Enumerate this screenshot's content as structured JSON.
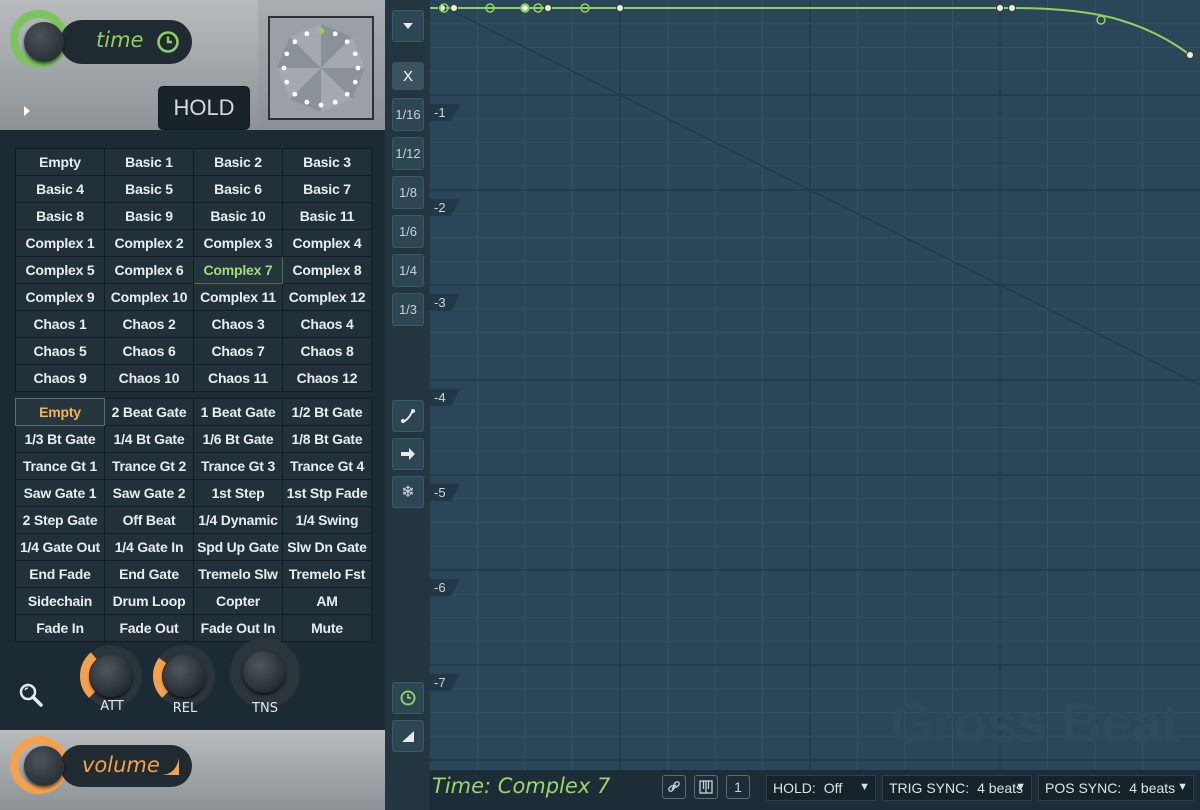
{
  "header": {
    "mode_label": "time",
    "hold_label": "HOLD"
  },
  "time_presets": [
    [
      "Empty",
      "Basic 1",
      "Basic 2",
      "Basic 3"
    ],
    [
      "Basic 4",
      "Basic 5",
      "Basic 6",
      "Basic 7"
    ],
    [
      "Basic 8",
      "Basic 9",
      "Basic 10",
      "Basic 11"
    ],
    [
      "Complex 1",
      "Complex 2",
      "Complex 3",
      "Complex 4"
    ],
    [
      "Complex 5",
      "Complex 6",
      "Complex 7",
      "Complex 8"
    ],
    [
      "Complex 9",
      "Complex 10",
      "Complex 11",
      "Complex 12"
    ],
    [
      "Chaos 1",
      "Chaos 2",
      "Chaos 3",
      "Chaos 4"
    ],
    [
      "Chaos 5",
      "Chaos 6",
      "Chaos 7",
      "Chaos 8"
    ],
    [
      "Chaos 9",
      "Chaos 10",
      "Chaos 11",
      "Chaos 12"
    ]
  ],
  "time_selected": "Complex 7",
  "volume_presets": [
    [
      "Empty",
      "2 Beat Gate",
      "1 Beat Gate",
      "1/2 Bt Gate"
    ],
    [
      "1/3 Bt Gate",
      "1/4 Bt Gate",
      "1/6 Bt Gate",
      "1/8 Bt Gate"
    ],
    [
      "Trance Gt 1",
      "Trance Gt 2",
      "Trance Gt 3",
      "Trance Gt 4"
    ],
    [
      "Saw Gate 1",
      "Saw Gate 2",
      "1st Step",
      "1st Stp Fade"
    ],
    [
      "2 Step Gate",
      "Off Beat",
      "1/4 Dynamic",
      "1/4 Swing"
    ],
    [
      "1/4 Gate Out",
      "1/4 Gate In",
      "Spd Up Gate",
      "Slw Dn Gate"
    ],
    [
      "End Fade",
      "End Gate",
      "Tremelo Slw",
      "Tremelo Fst"
    ],
    [
      "Sidechain",
      "Drum Loop",
      "Copter",
      "AM"
    ],
    [
      "Fade In",
      "Fade Out",
      "Fade Out In",
      "Mute"
    ]
  ],
  "volume_selected": "Empty",
  "knobs": {
    "att": {
      "label": "ATT",
      "value": 0.35
    },
    "rel": {
      "label": "REL",
      "value": 0.3
    },
    "tns": {
      "label": "TNS",
      "value": 0.5
    }
  },
  "footer": {
    "mode_label": "volume"
  },
  "toolbar": {
    "clear_label": "X",
    "snap_options": [
      "1/16",
      "1/12",
      "1/8",
      "1/6",
      "1/4",
      "1/3"
    ]
  },
  "graph": {
    "y_labels": [
      "-1",
      "-2",
      "-3",
      "-4",
      "-5",
      "-6",
      "-7"
    ],
    "watermark": "Gross Beat"
  },
  "status_bar": {
    "title": "Time: Complex 7",
    "step_label": "1",
    "hold": {
      "label": "HOLD:",
      "value": "Off"
    },
    "trig_sync": {
      "label": "TRIG SYNC:",
      "value": "4 beats"
    },
    "pos_sync": {
      "label": "POS SYNC:",
      "value": "4 beats"
    }
  },
  "colors": {
    "accent_green": "#7cc45b",
    "accent_orange": "#f5a14a",
    "graph_bg": "#2a4658"
  }
}
